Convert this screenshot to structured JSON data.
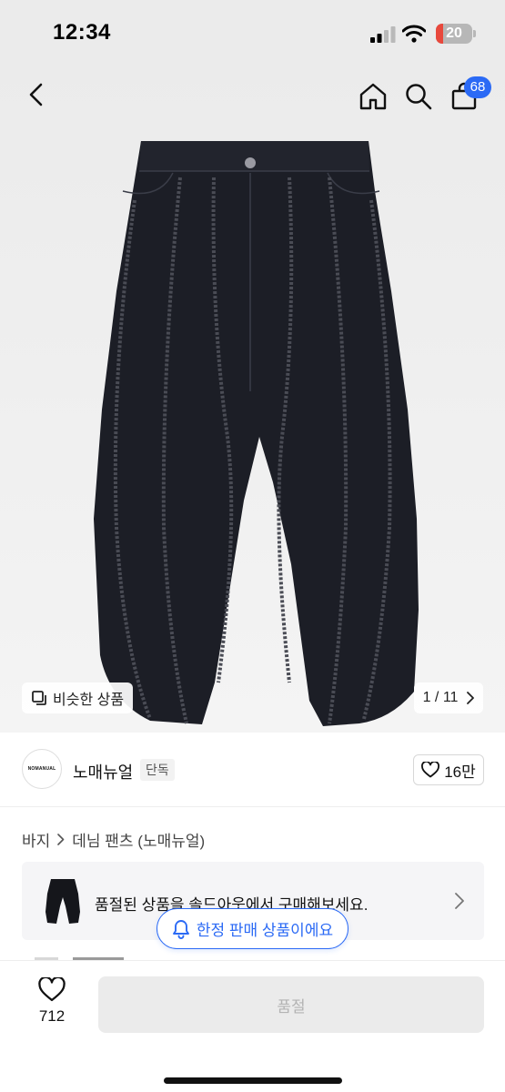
{
  "status_bar": {
    "time": "12:34",
    "battery": "20",
    "battery_level": 0.2
  },
  "nav": {
    "cart_count": "68",
    "icons": [
      "chevron-left-icon",
      "home-icon",
      "search-icon",
      "bag-icon"
    ]
  },
  "gallery": {
    "similar_label": "비슷한 상품",
    "counter": "1 / 11"
  },
  "brand": {
    "logo_text": "NOMANUAL",
    "name": "노매뉴얼",
    "badge": "단독",
    "likes": "16만"
  },
  "breadcrumb": {
    "category": "바지",
    "subcategory": "데님 팬츠 (노매뉴얼)"
  },
  "soldout_banner": {
    "text": "품절된 상품을 솔드아웃에서 구매해보세요."
  },
  "limited_tooltip": {
    "text": "한정 판매 상품이에요"
  },
  "bottom_bar": {
    "wish_count": "712",
    "buy_label": "품절"
  },
  "colors": {
    "accent": "#2b6af5",
    "battery_low": "#e8483c",
    "disabled_bg": "#ebebeb",
    "disabled_text": "#b3b3b3"
  }
}
